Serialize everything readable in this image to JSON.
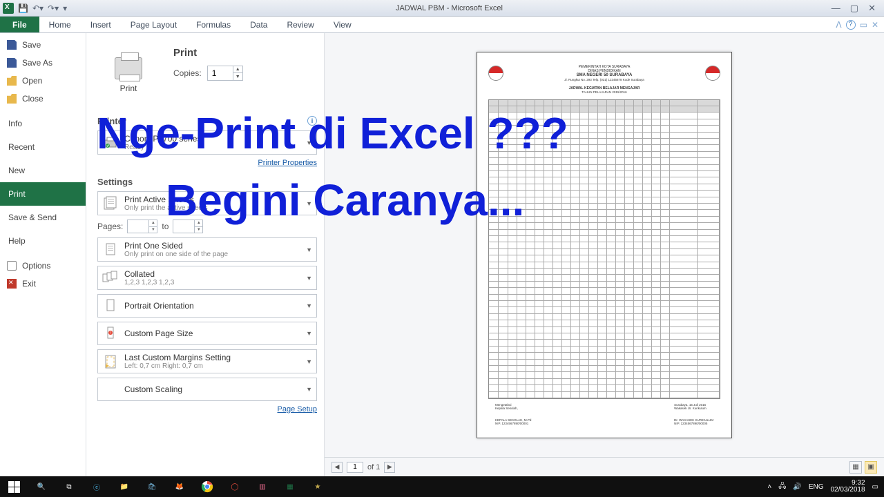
{
  "titlebar": {
    "title": "JADWAL PBM  -  Microsoft Excel"
  },
  "ribbon": {
    "tabs": [
      "File",
      "Home",
      "Insert",
      "Page Layout",
      "Formulas",
      "Data",
      "Review",
      "View"
    ]
  },
  "leftnav": {
    "items": [
      {
        "label": "Save",
        "icon": "save"
      },
      {
        "label": "Save As",
        "icon": "saveas"
      },
      {
        "label": "Open",
        "icon": "open"
      },
      {
        "label": "Close",
        "icon": "close"
      }
    ],
    "plain": [
      "Info",
      "Recent",
      "New",
      "Print",
      "Save & Send",
      "Help"
    ],
    "bottom": [
      {
        "label": "Options",
        "icon": "opt"
      },
      {
        "label": "Exit",
        "icon": "exit"
      }
    ],
    "selected": "Print"
  },
  "print": {
    "button_label": "Print",
    "header": "Print",
    "copies_label": "Copies:",
    "copies_value": "1"
  },
  "printer": {
    "section": "Printer",
    "name": "Canon iP2700 series",
    "status": "Ready",
    "properties_link": "Printer Properties"
  },
  "settings": {
    "section": "Settings",
    "active_sheets": {
      "t1": "Print Active Sheets",
      "t2": "Only print the active sheets"
    },
    "pages_label": "Pages:",
    "pages_to": "to",
    "one_sided": {
      "t1": "Print One Sided",
      "t2": "Only print on one side of the page"
    },
    "collated": {
      "t1": "Collated",
      "t2": "1,2,3    1,2,3    1,2,3"
    },
    "orientation": {
      "t1": "Portrait Orientation"
    },
    "pagesize": {
      "t1": "Custom Page Size"
    },
    "margins": {
      "t1": "Last Custom Margins Setting",
      "t2": "Left:  0,7 cm    Right:  0,7 cm"
    },
    "scaling": {
      "t1": "Custom Scaling"
    },
    "page_setup": "Page Setup"
  },
  "preview": {
    "header_lines": {
      "l1": "PEMERINTAH KOTA SURABAYA",
      "l2": "DINAS PENDIDIKAN",
      "l3": "SMA NEGERI 50 SURABAYA",
      "l4": "Jl. Rungkut No. 293 Telp. (031) 12345678 Kode Surabaya"
    },
    "sub1": "JADWAL KEGIATAN BELAJAR MENGAJAR",
    "sub2": "TAHUN PELAJARAN 2015/2016",
    "sig_left_1": "Mengetahui",
    "sig_left_2": "Kepala Sekolah,",
    "sig_right_1": "Surabaya, 15 Juli 2015",
    "sig_right_2": "Wakasek Ur. Kurikulum",
    "sig_left_name": "KEPALA SEKOLAH, M.Pd",
    "sig_left_nip": "NIP. 1234567890/00001",
    "sig_right_name": "Dr. WAKASEK KURIKULUM",
    "sig_right_nip": "NIP. 1234567890/00005",
    "footer": {
      "page": "1",
      "of_label": "of 1"
    }
  },
  "taskbar": {
    "lang": "ENG",
    "time": "9:32",
    "date": "02/03/2018"
  },
  "overlay": {
    "line1": "Nge-Print di Excel ???",
    "line2": "Begini Caranya..."
  }
}
